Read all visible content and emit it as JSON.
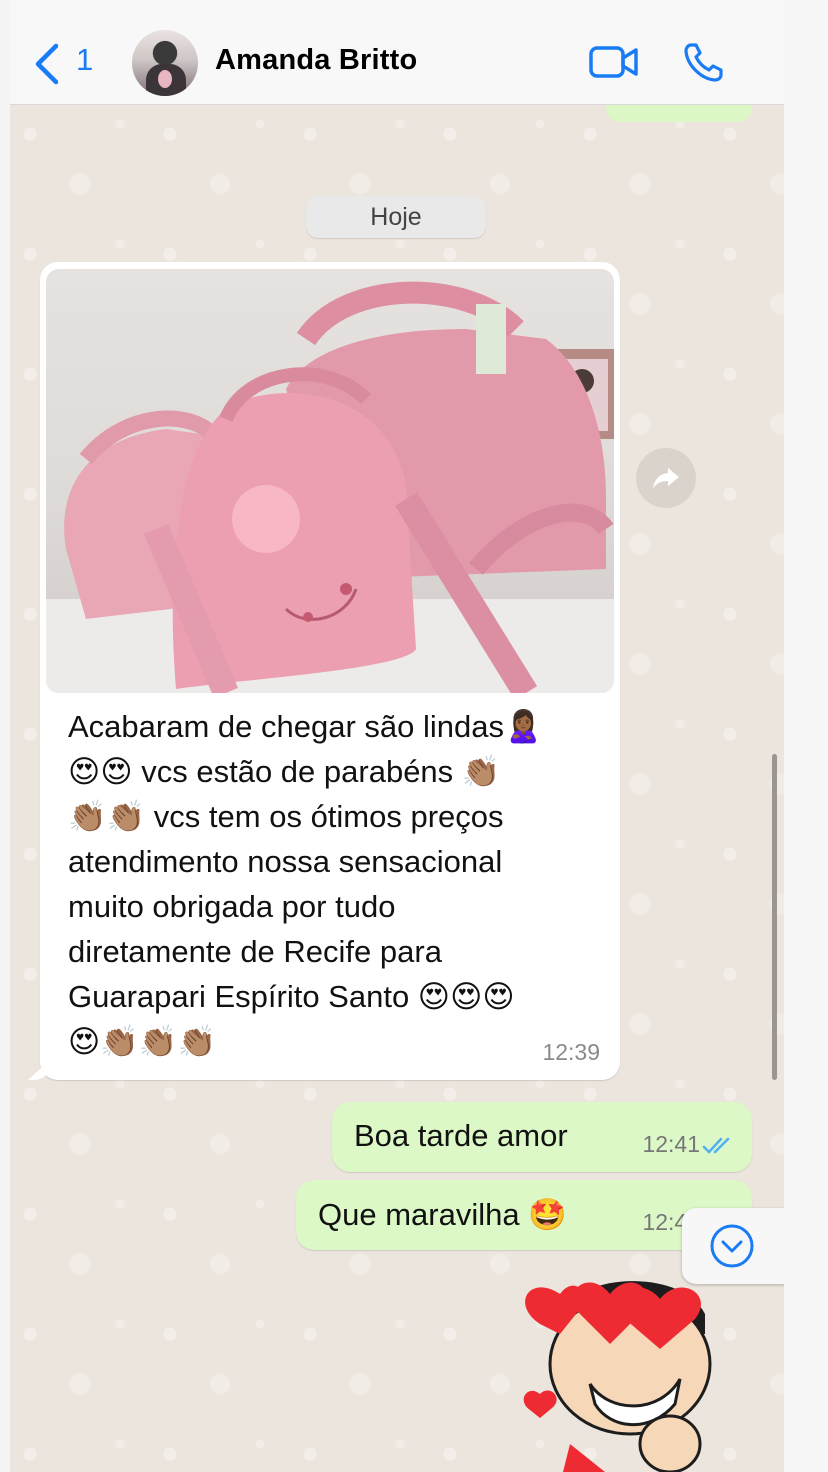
{
  "header": {
    "back_count": "1",
    "contact_name": "Amanda Britto",
    "accent_color": "#1a7cf5"
  },
  "chat": {
    "date_label": "Hoje",
    "incoming": {
      "text": "Acabaram de chegar são lindas🙎🏾‍♀️\n😍😍 vcs estão de parabéns 👏🏽\n👏🏽👏🏽 vcs tem os ótimos preços\natendimento nossa sensacional\nmuito obrigada por tudo\ndiretamente de Recife para\nGuarapari Espírito Santo 😍😍😍\n😍👏🏽👏🏽👏🏽",
      "time": "12:39"
    },
    "outgoing": [
      {
        "text": "Boa tarde amor",
        "time": "12:41"
      },
      {
        "text": "Que maravilha 🤩",
        "time": "12:41"
      }
    ]
  },
  "icons": {
    "back": "chevron-left-icon",
    "video": "video-camera-icon",
    "call": "phone-icon",
    "forward": "forward-arrow-icon",
    "read": "double-check-icon",
    "scroll_down": "chevron-down-circle-icon"
  },
  "colors": {
    "incoming_bubble": "#ffffff",
    "outgoing_bubble": "#dcf8c6",
    "read_ticks": "#4fb0f4",
    "chat_background": "#ece5dd"
  }
}
